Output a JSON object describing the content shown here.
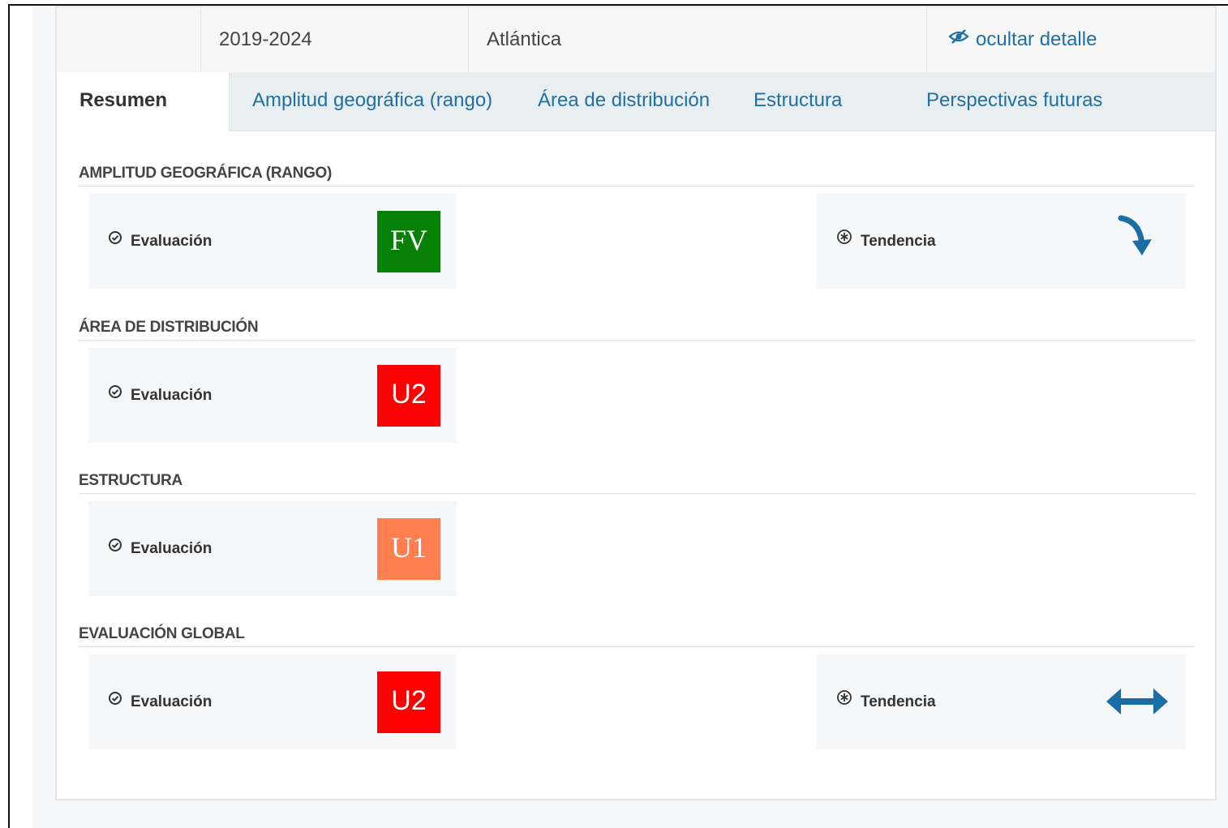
{
  "header": {
    "empty_cell": "",
    "period": "2019-2024",
    "region": "Atlántica",
    "toggle_detail": "ocultar detalle"
  },
  "tabs": [
    {
      "label": "Resumen",
      "active": true
    },
    {
      "label": "Amplitud geográfica (rango)",
      "active": false
    },
    {
      "label": "Área de distribución",
      "active": false
    },
    {
      "label": "Estructura",
      "active": false
    },
    {
      "label": "Perspectivas futuras",
      "active": false
    }
  ],
  "sections": [
    {
      "title": "AMPLITUD GEOGRÁFICA (RANGO)",
      "evaluation_label": "Evaluación",
      "evaluation_value": "FV",
      "evaluation_color": "#078007",
      "trend_label": "Tendencia",
      "trend_icon": "arrow-curved-down-icon"
    },
    {
      "title": "ÁREA DE DISTRIBUCIÓN",
      "evaluation_label": "Evaluación",
      "evaluation_value": "U2",
      "evaluation_color": "#ff0000"
    },
    {
      "title": "ESTRUCTURA",
      "evaluation_label": "Evaluación",
      "evaluation_value": "U1",
      "evaluation_color": "#ff7f50"
    },
    {
      "title": "EVALUACIÓN GLOBAL",
      "evaluation_label": "Evaluación",
      "evaluation_value": "U2",
      "evaluation_color": "#ff0000",
      "trend_label": "Tendencia",
      "trend_icon": "arrow-left-right-icon"
    }
  ],
  "colors": {
    "link": "#1f6fa5",
    "arrow": "#1a6ea3"
  }
}
